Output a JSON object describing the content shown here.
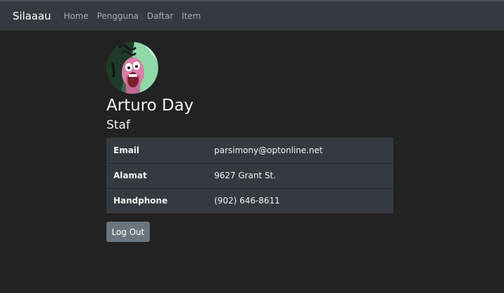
{
  "navbar": {
    "brand": "Silaaau",
    "links": [
      "Home",
      "Pengguna",
      "Daftar",
      "Item"
    ]
  },
  "profile": {
    "name": "Arturo Day",
    "role": "Staf",
    "fields": [
      {
        "label": "Email",
        "value": "parsimony@optonline.net"
      },
      {
        "label": "Alamat",
        "value": "9627 Grant St."
      },
      {
        "label": "Handphone",
        "value": "(902) 646-8611"
      }
    ],
    "logout_label": "Log Out"
  },
  "colors": {
    "background": "#222222",
    "navbar": "#343a40",
    "table": "#343a40",
    "button": "#6c757d"
  }
}
